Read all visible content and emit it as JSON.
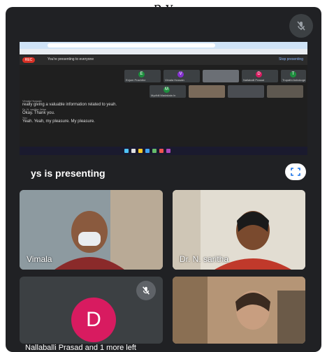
{
  "page_caption": "p  y",
  "top_mic_icon": "mic-off-icon",
  "presentation": {
    "presenting_label": "ys is presenting",
    "fullscreen_icon": "fullscreen-icon",
    "screen": {
      "rec_label": "REC",
      "banner_text": "You're presenting to everyone",
      "stop_label": "Stop presenting",
      "mini_tiles": [
        {
          "initial": "E",
          "color": "#1e8e3e",
          "name": "Enjum Prachthe"
        },
        {
          "initial": "V",
          "color": "#8430ce",
          "name": "Vimala Hussain"
        },
        {
          "initial": "D",
          "color": "#d81b60",
          "name": "Nallaballi Prasad"
        },
        {
          "initial": "T",
          "color": "#1e8e3e",
          "name": "Trupathi Ashokoge"
        },
        {
          "initial": "M",
          "color": "#1e8e3e",
          "name": "Mydhili Madakala In"
        }
      ],
      "chat_lines": [
        {
          "text": "Vimala Hussain",
          "small": true
        },
        {
          "text": "really giving a valuable information related to yeah.",
          "small": false
        },
        {
          "text": "Dr. N. saritha Jetun",
          "small": true
        },
        {
          "text": "Okay. Thank you.",
          "small": false
        },
        {
          "text": "You",
          "small": true
        },
        {
          "text": "Yeah. Yeah, my pleasure. My pleasure.",
          "small": false
        }
      ]
    }
  },
  "participants": [
    {
      "name": "Vimala",
      "kind": "video"
    },
    {
      "name": "Dr. N. saritha",
      "kind": "video"
    },
    {
      "name": "",
      "kind": "avatar",
      "initial": "D",
      "avatar_color": "#d81b60",
      "mic_icon": "mic-off-icon"
    },
    {
      "name": "",
      "kind": "video"
    }
  ],
  "toast": "Nallaballi Prasad and 1 more left"
}
